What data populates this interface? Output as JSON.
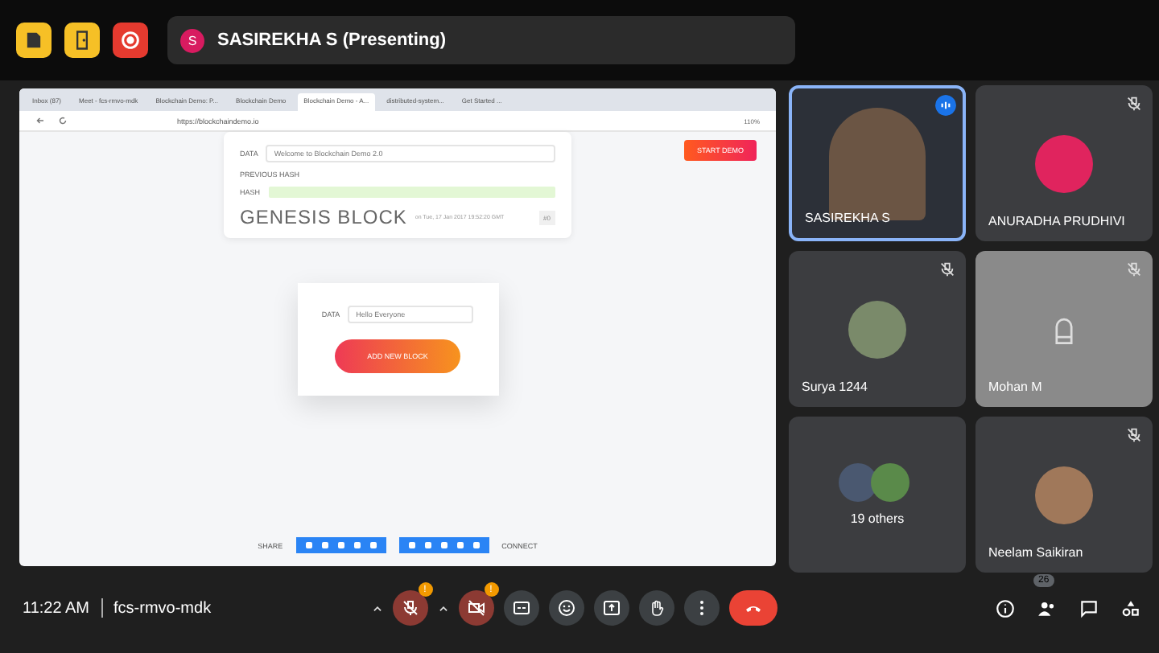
{
  "top_bar": {
    "presenter_initial": "S",
    "presenter_label": "SASIREKHA S (Presenting)"
  },
  "shared_screen": {
    "tabs": [
      {
        "label": "Inbox (87)",
        "selected": false
      },
      {
        "label": "Meet - fcs-rmvo-mdk",
        "selected": false
      },
      {
        "label": "Blockchain Demo: P...",
        "selected": false
      },
      {
        "label": "Blockchain Demo",
        "selected": false
      },
      {
        "label": "Blockchain Demo - A...",
        "selected": true
      },
      {
        "label": "distributed-system...",
        "selected": false
      },
      {
        "label": "Get Started ...",
        "selected": false
      }
    ],
    "address": "https://blockchaindemo.io",
    "zoom": "110%",
    "start_button": "START DEMO",
    "block": {
      "data_label": "DATA",
      "data_value": "Welcome to Blockchain Demo 2.0",
      "previous_hash_label": "PREVIOUS HASH",
      "hash_label": "HASH",
      "title": "GENESIS BLOCK",
      "timestamp": "on Tue, 17 Jan 2017 19:52:20 GMT",
      "index": "#0"
    },
    "new_block": {
      "data_label": "DATA",
      "data_value": "Hello Everyone",
      "button": "ADD NEW BLOCK"
    },
    "share_label": "SHARE",
    "connect_label": "CONNECT"
  },
  "participants": [
    {
      "name": "SASIREKHA S",
      "kind": "video",
      "speaking": true,
      "muted": false
    },
    {
      "name": "ANURADHA PRUDHIVI",
      "kind": "avatar",
      "speaking": false,
      "muted": true,
      "color": "#e0245e"
    },
    {
      "name": "Surya 1244",
      "kind": "avatar",
      "speaking": false,
      "muted": true,
      "color": "#7a8a6a"
    },
    {
      "name": "Mohan M",
      "kind": "placeholder",
      "speaking": false,
      "muted": true
    },
    {
      "name": "19 others",
      "kind": "others",
      "speaking": false,
      "muted": false
    },
    {
      "name": "Neelam Saikiran",
      "kind": "avatar",
      "speaking": false,
      "muted": true,
      "color": "#a0785a"
    }
  ],
  "bottom_bar": {
    "time": "11:22 AM",
    "meeting_code": "fcs-rmvo-mdk",
    "controls": [
      {
        "kind": "mic",
        "on": false,
        "badge": "!"
      },
      {
        "kind": "camera",
        "on": false,
        "badge": "!"
      },
      {
        "kind": "captions",
        "on": true
      },
      {
        "kind": "emoji",
        "on": true
      },
      {
        "kind": "present",
        "on": true
      },
      {
        "kind": "hand",
        "on": true
      },
      {
        "kind": "more",
        "on": true
      },
      {
        "kind": "end"
      }
    ],
    "people_count": "26"
  }
}
